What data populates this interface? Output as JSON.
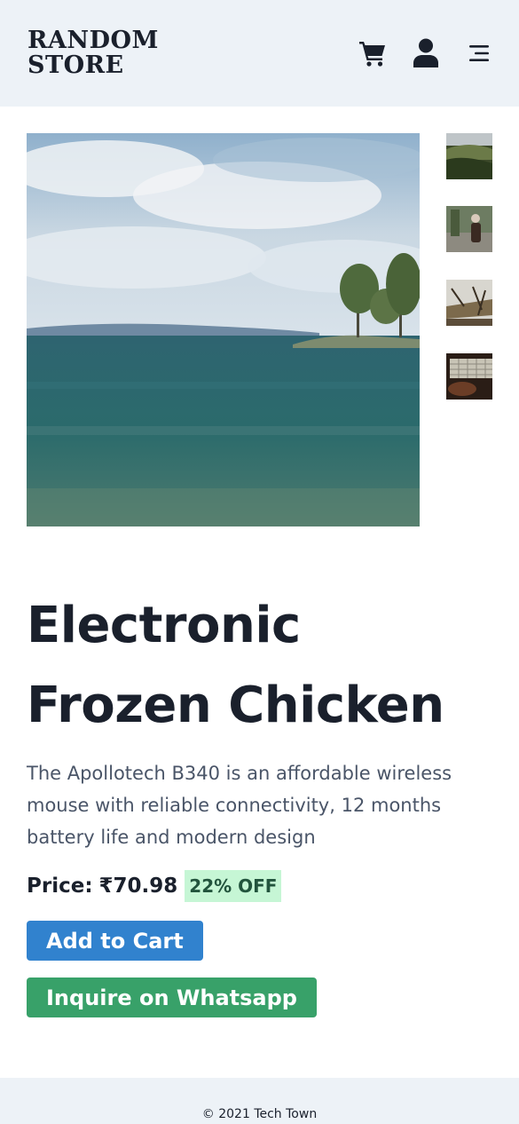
{
  "header": {
    "logo_line1": "RANDOM",
    "logo_line2": "STORE",
    "icons": [
      "cart-icon",
      "user-icon",
      "menu-icon"
    ]
  },
  "gallery": {
    "main_image": "seascape with island and trees",
    "thumbnails": [
      "hill landscape",
      "woman in clearing",
      "forest debris",
      "keyboard on desk"
    ]
  },
  "product": {
    "title": "Electronic Frozen Chicken",
    "description": "The Apollotech B340 is an affordable wireless mouse with reliable connectivity, 12 months battery life and modern design",
    "price_label": "Price:",
    "price": "₹70.98",
    "discount": "22% OFF",
    "add_to_cart": "Add to Cart",
    "inquire": "Inquire on Whatsapp"
  },
  "footer": {
    "text": "© 2021 Tech Town"
  },
  "colors": {
    "header_bg": "#edf2f7",
    "add_to_cart": "#3182ce",
    "whatsapp": "#38a169",
    "discount_bg": "#c6f6d5",
    "text": "#1a202c",
    "muted": "#4a5568"
  }
}
